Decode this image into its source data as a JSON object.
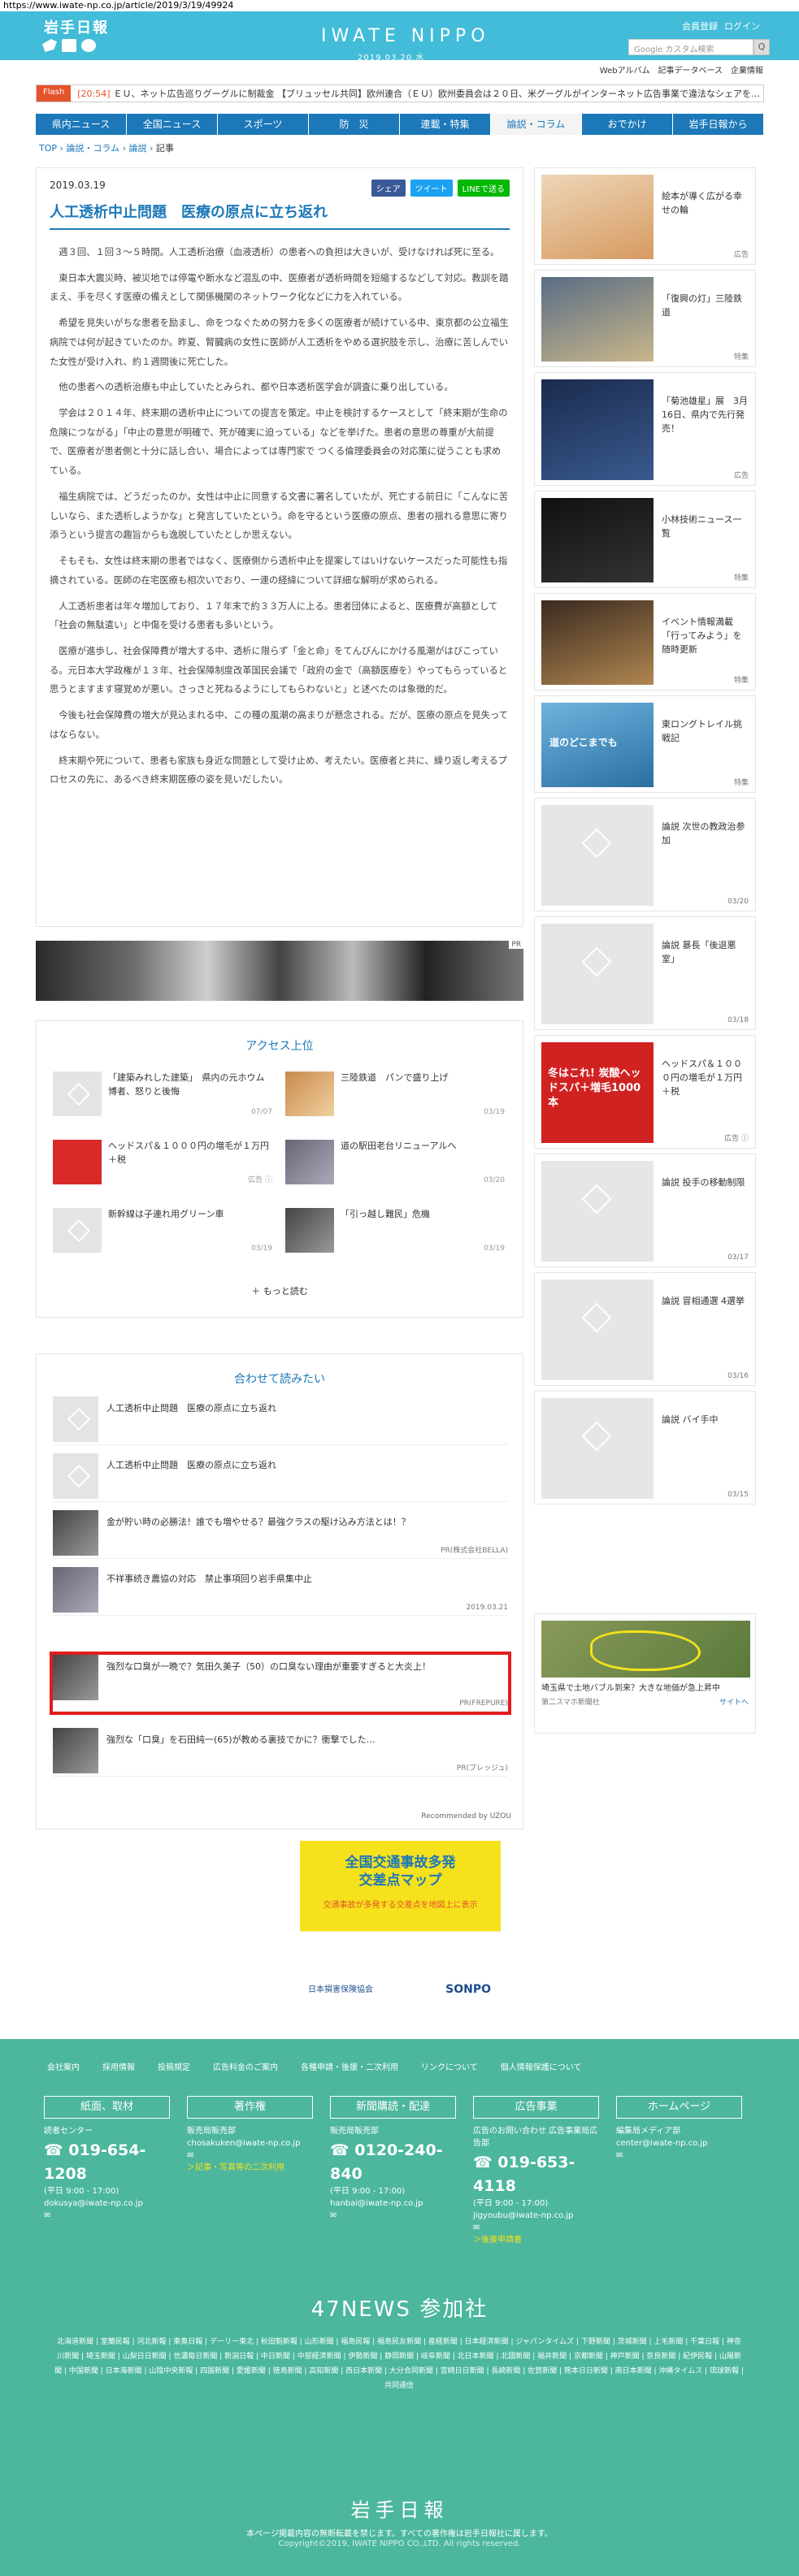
{
  "browser": {
    "url": "https://www.iwate-np.co.jp/article/2019/3/19/49924"
  },
  "header": {
    "logo_jp": "岩手日報",
    "logo_en": "IWATE NIPPO",
    "date": "2019.03.20.水",
    "register": "会員登録",
    "login": "ログイン",
    "search_placeholder": "Google カスタム検索",
    "search_button": "Q"
  },
  "subnav": [
    "Webアルバム",
    "記事データベース",
    "企業情報"
  ],
  "flash": {
    "tag": "Flash",
    "time": "[20:54]",
    "text": "ＥＵ、ネット広告巡りグーグルに制裁金 【ブリュッセル共同】欧州連合（ＥＵ）欧州委員会は２０日、米グーグルがインターネット広告事業で違法なシェアを…"
  },
  "catnav": [
    "県内ニュース",
    "全国ニュース",
    "スポーツ",
    "防　災",
    "連載・特集",
    "論説・コラム",
    "おでかけ",
    "岩手日報から"
  ],
  "breadcrumb": [
    "TOP",
    "論説・コラム",
    "論説",
    "記事"
  ],
  "article": {
    "date": "2019.03.19",
    "share_fb": "シェア",
    "share_tw": "ツイート",
    "share_line": "LINEで送る",
    "title": "人工透析中止問題　医療の原点に立ち返れ",
    "paragraphs": [
      "週３回、１回３～５時間。人工透析治療（血液透析）の患者への負担は大きいが、受けなければ死に至る。",
      "東日本大震災時、被災地では停電や断水など混乱の中、医療者が透析時間を短縮するなどして対応。教訓を踏まえ、手を尽くす医療の備えとして関係機関のネットワーク化などに力を入れている。",
      "希望を見失いがちな患者を励まし、命をつなぐための努力を多くの医療者が続けている中、東京都の公立福生病院では何が起きていたのか。昨夏、腎臓病の女性に医師が人工透析をやめる選択肢を示し、治療に苦しんでいた女性が受け入れ、約１週間後に死亡した。",
      "他の患者への透析治療も中止していたとみられ、都や日本透析医学会が調査に乗り出している。",
      "学会は２０１４年、終末期の透析中止についての提言を策定。中止を検討するケースとして「終末期が生命の危険につながる」「中止の意思が明確で、死が確実に迫っている」などを挙げた。患者の意思の尊重が大前提で、医療者が患者側と十分に話し合い、場合によっては専門家で つくる倫理委員会の対応策に従うことも求めている。",
      "福生病院では、どうだったのか。女性は中止に同意する文書に署名していたが、死亡する前日に「こんなに苦しいなら、また透析しようかな」と発言していたという。命を守るという医療の原点、患者の揺れる意思に寄り添うという提言の趣旨からも逸脱していたとしか思えない。",
      "そもそも、女性は終末期の患者ではなく、医療側から透析中止を提案してはいけないケースだった可能性も指摘されている。医師の在宅医療も相次いでおり、一連の経緯について詳細な解明が求められる。",
      "人工透析患者は年々増加しており、１７年末で約３３万人に上る。患者団体によると、医療費が高額として「社会の無駄遣い」と中傷を受ける患者も多いという。",
      "医療が進歩し、社会保障費が増大する中、透析に限らず「金と命」をてんびんにかける風潮がはびこっている。元日本大学政権が１３年、社会保障制度改革国民会議で「政府の金で（高額医療を）やってもらっていると思うとますます寝覚めが悪い。さっさと死ねるようにしてもらわないと」と述べたのは象徴的だ。",
      "今後も社会保障費の増大が見込まれる中、この種の風潮の高まりが懸念される。だが、医療の原点を見失ってはならない。",
      "終末期や死について、患者も家族も身近な問題として受け止め、考えたい。医療者と共に、繰り返し考えるプロセスの先に、あるべき終末期医療の姿を見いだしたい。"
    ]
  },
  "strip_pr": "PR",
  "ranking": {
    "title": "アクセス上位",
    "items": [
      {
        "text": "「建築みれした建築」　県内の元ホウム博者、怒りと後悔",
        "date": "07/07"
      },
      {
        "text": "三陸鉄道　パンで盛り上げ",
        "date": "03/19"
      },
      {
        "text": "ヘッドスパ＆１０００円の増毛が１万円＋税",
        "date": "広告 ⓘ"
      },
      {
        "text": "道の駅田老台リニューアルへ",
        "date": "03/20"
      },
      {
        "text": "新幹線は子連れ用グリーン車",
        "date": "03/19"
      },
      {
        "text": "「引っ越し難民」危機",
        "date": "03/19"
      }
    ],
    "more": "もっと読む"
  },
  "related": {
    "title": "合わせて読みたい",
    "items": [
      {
        "text": "人工透析中止問題　医療の原点に立ち返れ",
        "meta": ""
      },
      {
        "text": "人工透析中止問題　医療の原点に立ち返れ",
        "meta": ""
      },
      {
        "text": "金が貯い時の必勝法！誰でも増やせる？最強クラスの駆け込み方法とは！？",
        "meta": "PR(株式会社BELLA)"
      },
      {
        "text": "不祥事続き農協の対応　禁止事項回り岩手県集中止",
        "meta": "2019.03.21"
      },
      {
        "text": "強烈な口臭が一晩で？気田久美子（50）の口臭ない理由が重要すぎると大炎上！",
        "meta": "PR(FREPURE)"
      },
      {
        "text": "強烈な「口臭」を石田純一(65)が教める裏技でかに？衝撃でした…",
        "meta": "PR(ブレッジュ)"
      }
    ],
    "recommend": "Recommended by UZOU"
  },
  "sidebar": [
    {
      "text": "絵本が導く広がる幸せの輪",
      "tag": "広告"
    },
    {
      "text": "「復興の灯」三陸鉄道",
      "tag": "特集"
    },
    {
      "text": "「菊池雄星」展　3月16日、県内で先行発売！",
      "tag": "広告"
    },
    {
      "text": "小林技術ニュース一覧",
      "tag": "特集"
    },
    {
      "text": "イベント情報満載「行ってみよう」を随時更新",
      "tag": "特集"
    },
    {
      "text": "東ロングトレイル挑戦記",
      "tag": "特集"
    },
    {
      "text": "論説 次世の教政治参加",
      "tag": "03/20"
    },
    {
      "text": "論説 暴長「後退悪室」",
      "tag": "03/18"
    },
    {
      "text": "ヘッドスパ＆１０００円の増毛が１万円＋税",
      "tag": "広告 ⓘ"
    },
    {
      "text": "論説 投手の移動制限",
      "tag": "03/17"
    },
    {
      "text": "論説 冒相通選 4選挙",
      "tag": "03/16"
    },
    {
      "text": "論説 バイ手中",
      "tag": "03/15"
    }
  ],
  "sidebar_img_text": {
    "trail": "道のどこまでも",
    "heater": "冬はこれ! 炭酸ヘッドスパ＋増毛1000本"
  },
  "map_ad": {
    "text": "埼玉県で土地バブル到来？大きな地価が急上昇中",
    "source": "第二スマホ新聞社",
    "link": "サイトへ"
  },
  "banner": {
    "title": "全国交通事故多発\n交差点マップ",
    "sub": "交通事故が多発する交差点を地図上に表示",
    "foot": "日本損害保険協会",
    "sonpo": "SONPO"
  },
  "footer": {
    "links": [
      "会社案内",
      "採用情報",
      "投稿規定",
      "広告料金のご案内",
      "各種申請・後援・二次利用",
      "リンクについて",
      "個人情報保護について"
    ],
    "cols": [
      {
        "head": "紙面、取材",
        "label": "読者センター",
        "tel": "019-654-1208",
        "hours": "(平日 9:00 - 17:00)",
        "mail": "dokusya@iwate-np.co.jp",
        "sub": ""
      },
      {
        "head": "著作権",
        "label": "販売局販売部",
        "tel": "",
        "hours": "",
        "mail": "chosakuken@iwate-np.co.jp",
        "sub": "＞記事・写真等の二次利用"
      },
      {
        "head": "新聞購読・配達",
        "label": "販売局販売部",
        "tel": "0120-240-840",
        "hours": "(平日 9:00 - 17:00)",
        "mail": "hanbai@iwate-np.co.jp",
        "sub": ""
      },
      {
        "head": "広告事業",
        "label": "広告のお問い合わせ 広告事業局広告部",
        "tel": "019-653-4118",
        "hours": "(平日 9:00 - 17:00)",
        "mail": "jigyoubu@iwate-np.co.jp",
        "sub": "＞後援申請書"
      },
      {
        "head": "ホームページ",
        "label": "編集局メディア部",
        "tel": "",
        "hours": "",
        "mail": "center@iwate-np.co.jp",
        "sub": ""
      }
    ],
    "news47": "47NEWS 参加社",
    "papers": "北海道新聞 | 室蘭民報 | 河北新報 | 東奥日報 | デーリー東北 | 秋田魁新報 | 山形新聞 | 福島民報 | 福島民友新聞 | 産経新聞 | 日本経済新聞 | ジャパンタイムズ | 下野新聞 | 茨城新聞 | 上毛新聞 | 千葉日報 | 神奈川新聞 | 埼玉新聞 | 山梨日日新聞 | 信濃毎日新聞 | 新潟日報 | 中日新聞 | 中部経済新聞 | 伊勢新聞 | 静岡新聞 | 岐阜新聞 | 北日本新聞 | 北國新聞 | 福井新聞 | 京都新聞 | 神戸新聞 | 奈良新聞 | 紀伊民報 | 山陽新聞 | 中国新聞 | 日本海新聞 | 山陰中央新報 | 四国新聞 | 愛媛新聞 | 徳島新聞 | 高知新聞 | 西日本新聞 | 大分合同新聞 | 宮崎日日新聞 | 長崎新聞 | 佐賀新聞 | 熊本日日新聞 | 南日本新聞 | 沖縄タイムス | 琉球新報 | 共同通信",
    "logo": "岩手日報",
    "copy1": "本ページ掲載内容の無断転載を禁じます。すべての著作権は岩手日報社に属します。",
    "copy2": "Copyright©2019, IWATE NIPPO CO.,LTD. All rights reserved."
  }
}
